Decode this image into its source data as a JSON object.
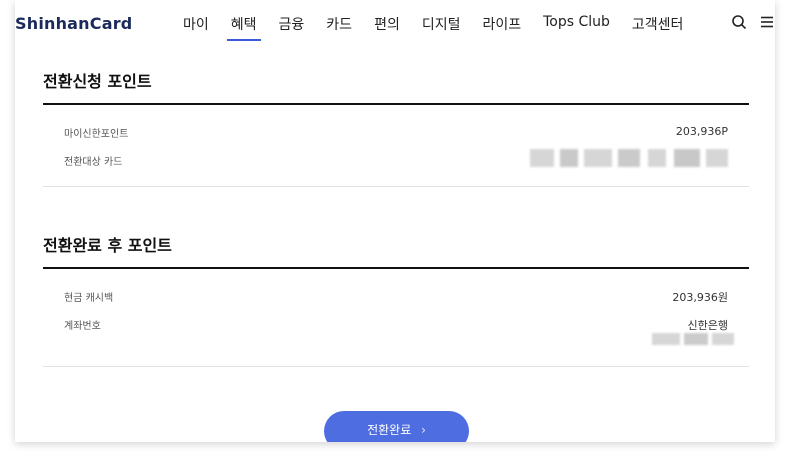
{
  "header": {
    "logo": "ShinhanCard",
    "nav": [
      "마이",
      "혜택",
      "금융",
      "카드",
      "편의",
      "디지털",
      "라이프",
      "Tops Club",
      "고객센터"
    ],
    "active_nav": "혜택"
  },
  "apply_section": {
    "title": "전환신청 포인트",
    "rows": [
      {
        "label": "마이신한포인트",
        "value": "203,936P"
      },
      {
        "label": "전환대상 카드",
        "value": ""
      }
    ]
  },
  "complete_section": {
    "title": "전환완료 후 포인트",
    "rows": [
      {
        "label": "현금 캐시백",
        "value": "203,936원"
      },
      {
        "label": "계좌번호",
        "value": "신한은행"
      }
    ]
  },
  "cta": {
    "label": "전환완료"
  },
  "colors": {
    "accent": "#4d6de0",
    "brand": "#1a2a5a"
  },
  "icons": [
    "search-icon",
    "menu-icon",
    "chevron-right-icon"
  ]
}
